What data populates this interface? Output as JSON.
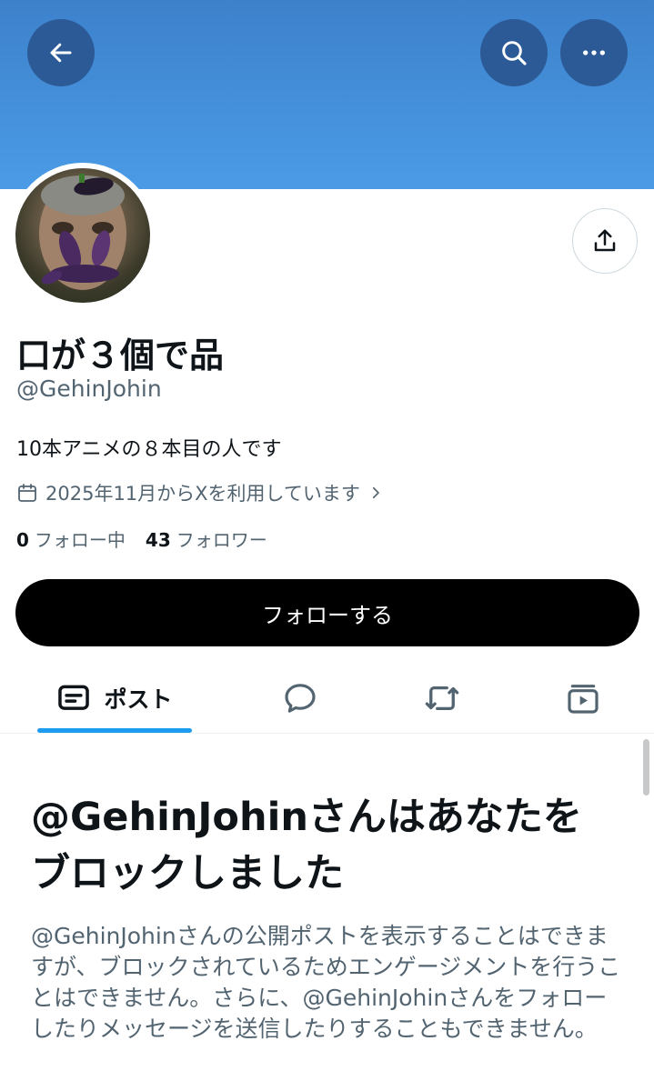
{
  "header": {
    "back_icon": "arrow-left-icon",
    "search_icon": "search-icon",
    "more_icon": "more-horizontal-icon",
    "banner_color": "#4a9be6"
  },
  "profile": {
    "display_name": "口が３個で品",
    "handle": "@GehinJohin",
    "bio": "10本アニメの８本目の人です",
    "joined": "2025年11月からXを利用しています",
    "following_count": "0",
    "following_label": "フォロー中",
    "followers_count": "43",
    "followers_label": "フォロワー",
    "follow_button": "フォローする",
    "share_icon": "share-icon"
  },
  "tabs": [
    {
      "label": "ポスト",
      "icon": "posts-icon",
      "active": true
    },
    {
      "label": "",
      "icon": "reply-icon",
      "active": false
    },
    {
      "label": "",
      "icon": "repost-icon",
      "active": false
    },
    {
      "label": "",
      "icon": "media-icon",
      "active": false
    }
  ],
  "blocked": {
    "title": "@GehinJohinさんはあなたをブロックしました",
    "description": "@GehinJohinさんの公開ポストを表示することはできますが、ブロックされているためエンゲージメントを行うことはできません。さらに、@GehinJohinさんをフォローしたりメッセージを送信したりすることもできません。"
  },
  "colors": {
    "accent": "#1d9bf0",
    "button_bg": "#000000",
    "muted_text": "#536471"
  }
}
